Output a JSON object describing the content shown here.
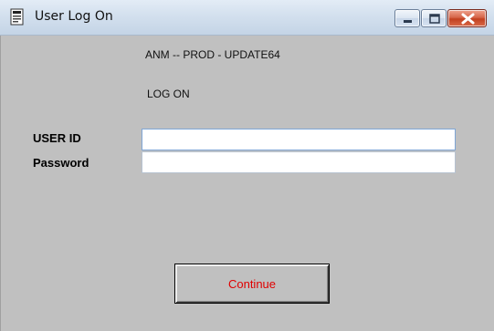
{
  "window": {
    "title": "User Log On",
    "controls": {
      "minimize_icon": "minimize-icon",
      "maximize_icon": "maximize-icon",
      "close_icon": "close-icon"
    }
  },
  "form": {
    "environment": "ANM -- PROD - UPDATE64",
    "heading": "LOG ON",
    "user_id_label": "USER ID",
    "user_id_value": "",
    "password_label": "Password",
    "password_value": "",
    "continue_label": "Continue"
  },
  "colors": {
    "client_background": "#c0c0c0",
    "continue_text": "#e00000",
    "close_button": "#c2401f"
  }
}
